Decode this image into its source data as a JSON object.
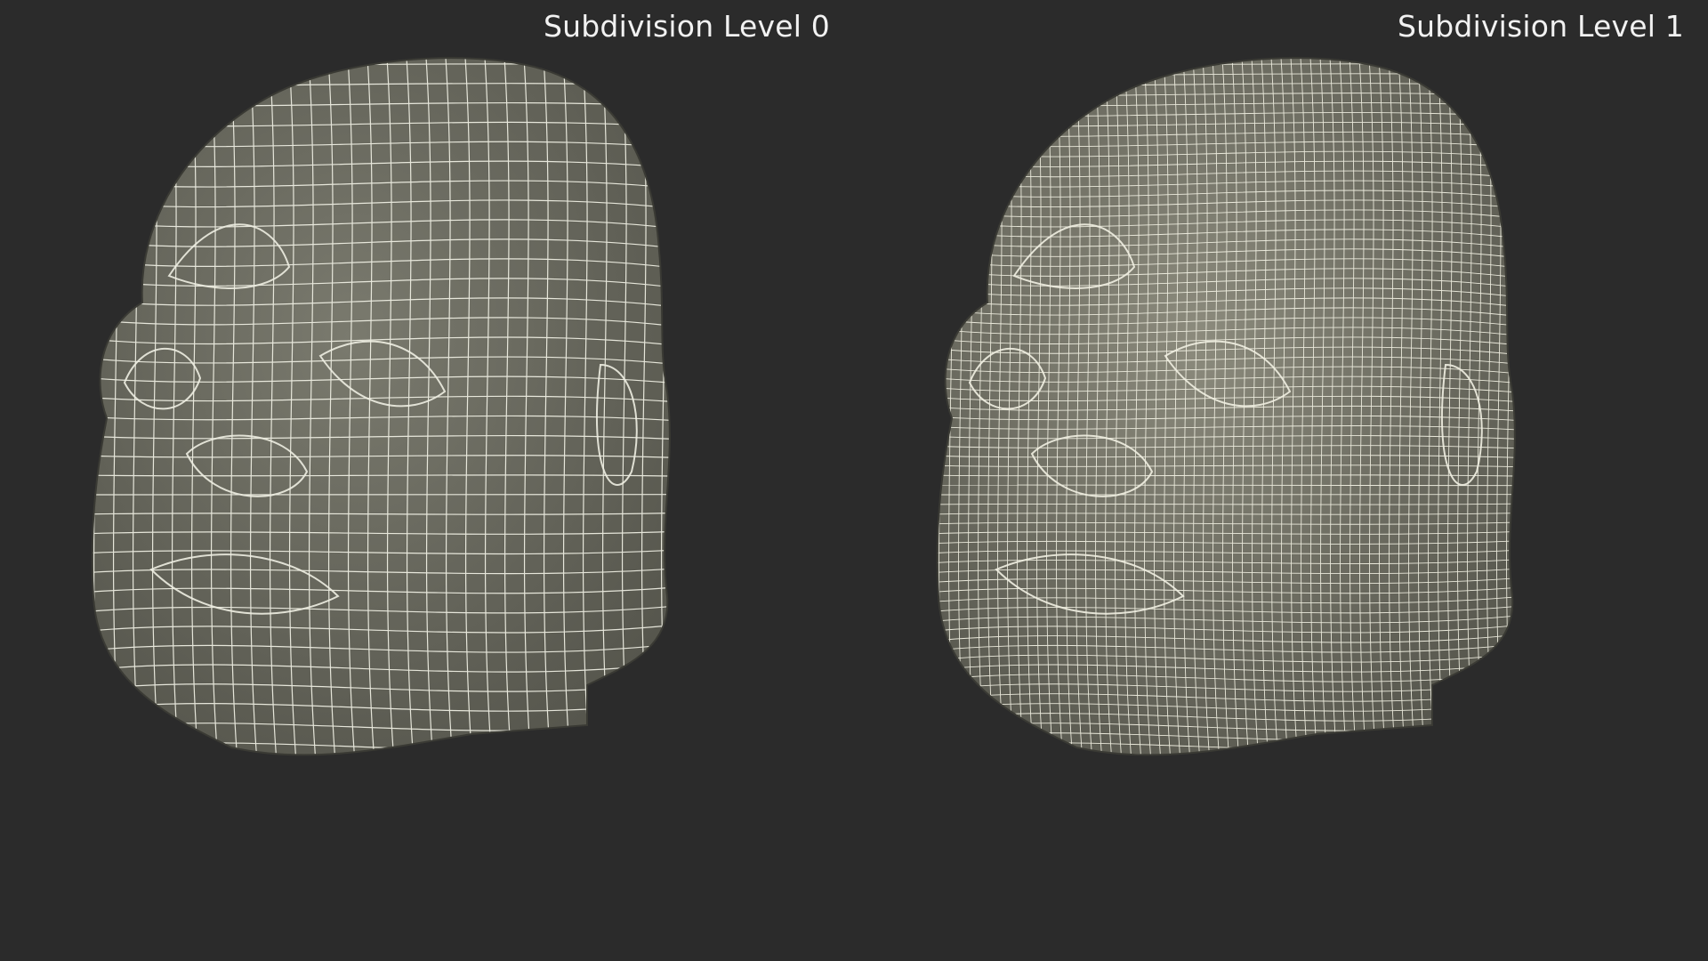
{
  "panels": {
    "left": {
      "caption": "Subdivision Level 0",
      "mesh_density": 1,
      "surface_color": "#7a7a6e",
      "wire_color": "#eeeee2"
    },
    "right": {
      "caption": "Subdivision Level 1",
      "mesh_density": 2,
      "surface_color": "#8c8b7d",
      "wire_color": "#f1f0e2"
    }
  },
  "background_color": "#2b2b2b"
}
